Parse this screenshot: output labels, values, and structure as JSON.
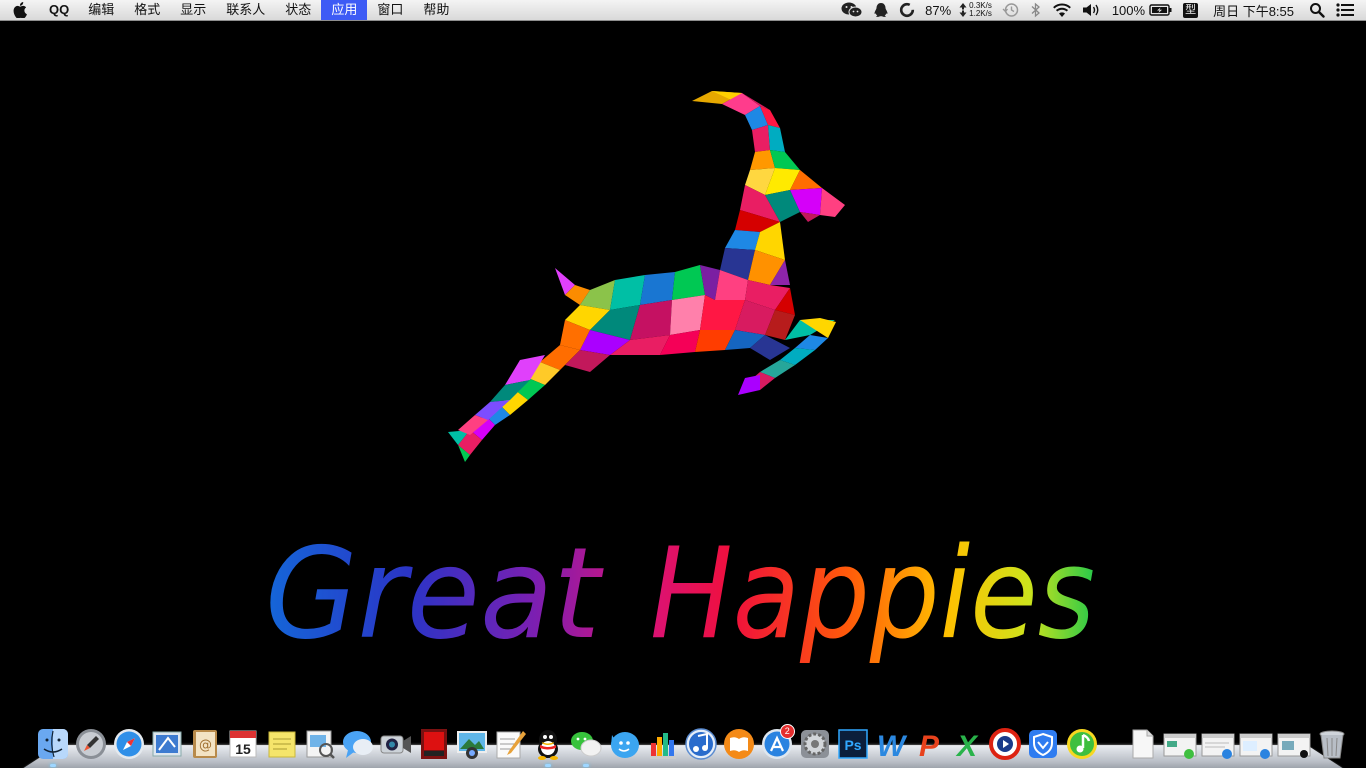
{
  "menubar": {
    "app_name": "QQ",
    "menus": [
      "编辑",
      "格式",
      "显示",
      "联系人",
      "状态",
      "应用",
      "窗口",
      "帮助"
    ],
    "active_menu": "应用",
    "battery_percent_label": "87%",
    "net_up": "0.3K/s",
    "net_down": "1.2K/s",
    "volume_percent": "100%",
    "input_method": "型",
    "clock": "周日 下午8:55"
  },
  "wallpaper": {
    "headline_word1": "Great",
    "headline_word2": "Happies"
  },
  "dock": {
    "apps": [
      "finder-icon",
      "launchpad-icon",
      "safari-icon",
      "mail-icon",
      "contacts-icon",
      "calendar-icon",
      "stickies-icon",
      "preview-icon",
      "messages-icon",
      "facetime-icon",
      "photo-booth-icon",
      "iphoto-icon",
      "textedit-icon",
      "qq-icon",
      "wechat-icon",
      "qq-browser-icon",
      "numbers-icon",
      "itunes-icon",
      "ibooks-icon",
      "app-store-icon",
      "system-preferences-icon",
      "photoshop-icon",
      "word-icon",
      "powerpoint-icon",
      "excel-icon",
      "video-player-icon",
      "security-shield-icon",
      "qq-music-icon"
    ],
    "calendar_day": "15",
    "app_store_badge": "2",
    "photoshop_label": "Ps",
    "word_label": "W",
    "powerpoint_label": "P",
    "excel_label": "X",
    "minimized": [
      "document-icon",
      "minimized-window-1",
      "minimized-window-2",
      "minimized-window-3",
      "minimized-window-4",
      "trash-icon"
    ]
  }
}
